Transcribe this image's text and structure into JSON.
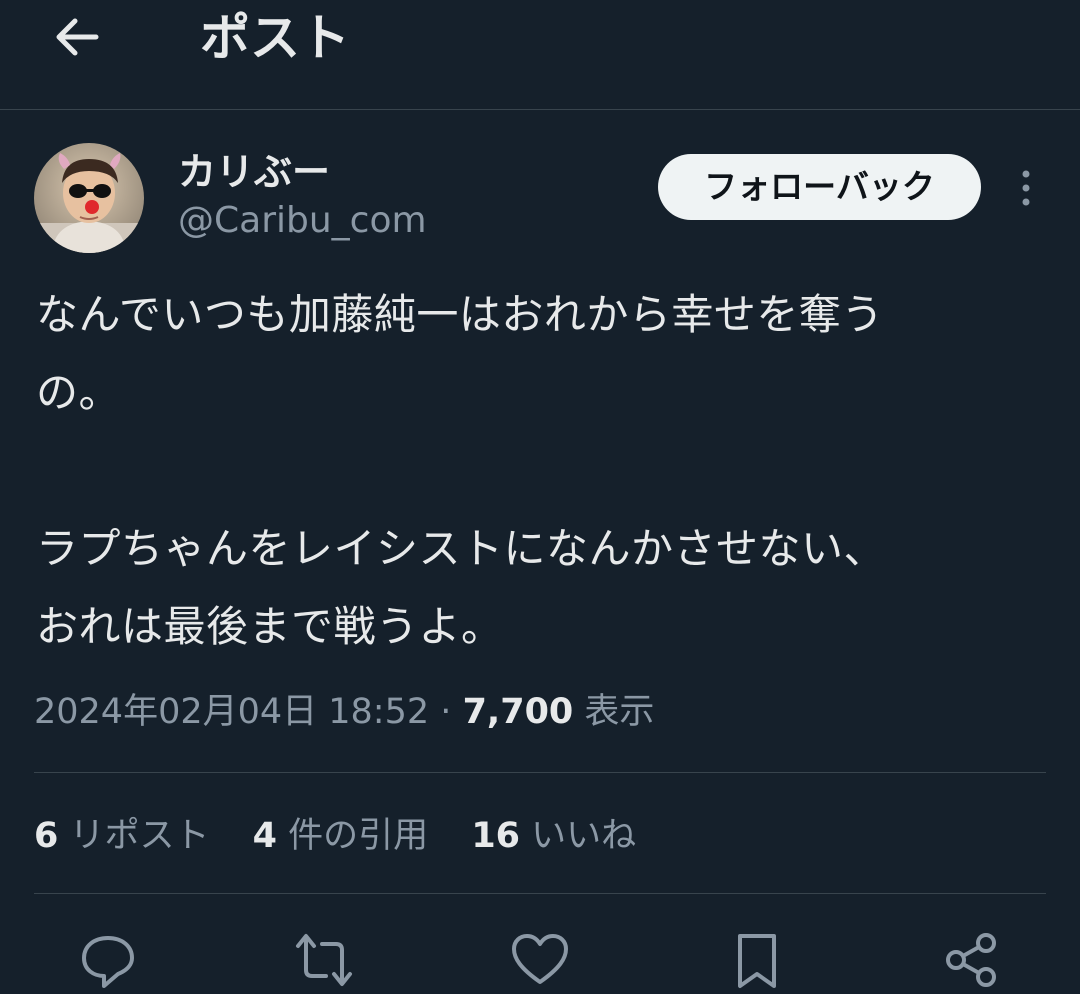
{
  "header": {
    "back_icon": "arrow-left-icon",
    "title": "ポスト"
  },
  "author": {
    "display_name": "カリぶー",
    "handle": "@Caribu_com",
    "follow_button_label": "フォローバック",
    "more_icon": "more-vertical-icon"
  },
  "tweet": {
    "paragraphs": [
      {
        "lines": [
          "なんでいつも加藤純一はおれから幸せを奪う",
          "の。"
        ]
      },
      {
        "lines": [
          "ラプちゃんをレイシストになんかさせない、",
          "おれは最後まで戦うよ。"
        ]
      }
    ]
  },
  "meta": {
    "timestamp": "2024年02月04日 18:52",
    "separator": "·",
    "views_count": "7,700",
    "views_label": "表示"
  },
  "stats": {
    "reposts": {
      "count": "6",
      "label": "リポスト"
    },
    "quotes": {
      "count": "4",
      "label": "件の引用"
    },
    "likes": {
      "count": "16",
      "label": "いいね"
    }
  },
  "actions": [
    {
      "icon": "reply-icon"
    },
    {
      "icon": "repost-icon"
    },
    {
      "icon": "like-icon"
    },
    {
      "icon": "bookmark-icon"
    },
    {
      "icon": "share-icon"
    }
  ],
  "colors": {
    "background": "#15202b",
    "text_primary": "#e7e9ea",
    "text_secondary": "#8b98a5",
    "divider": "#38444d",
    "follow_button_bg": "#eff3f4"
  }
}
